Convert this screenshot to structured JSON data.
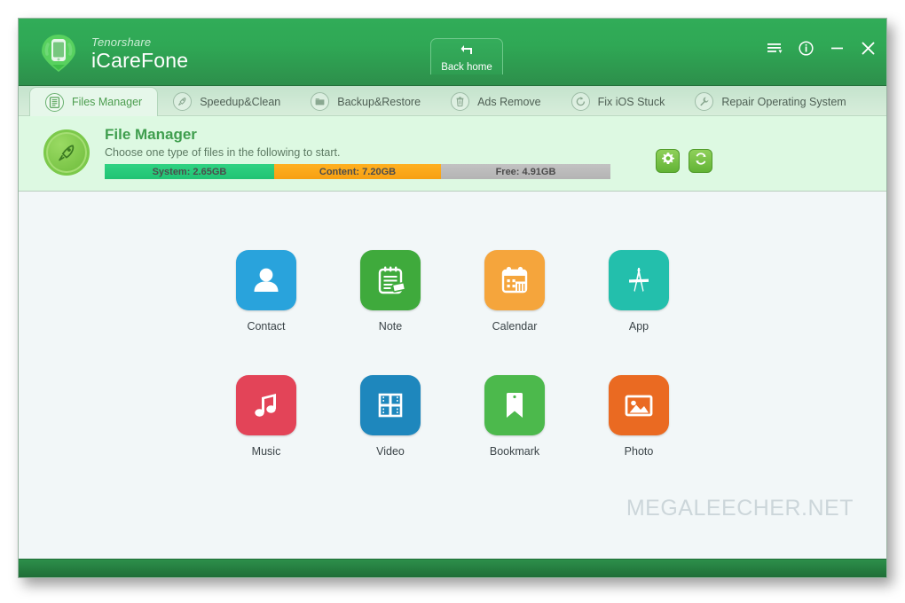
{
  "window": {
    "brand_sub": "Tenorshare",
    "brand_main": "iCareFone",
    "logo_icon": "phone-pin-logo-icon"
  },
  "titlebar": {
    "back_home_label": "Back home",
    "back_home_icon": "back-arrow-icon",
    "controls": [
      {
        "name": "menu-button",
        "icon": "hamburger-menu-icon"
      },
      {
        "name": "info-button",
        "icon": "info-circle-icon"
      },
      {
        "name": "minimize-button",
        "icon": "minimize-icon"
      },
      {
        "name": "close-button",
        "icon": "close-x-icon"
      }
    ]
  },
  "tabs": [
    {
      "label": "Files Manager",
      "icon": "document-list-icon",
      "active": true
    },
    {
      "label": "Speedup&Clean",
      "icon": "rocket-icon",
      "active": false
    },
    {
      "label": "Backup&Restore",
      "icon": "folder-icon",
      "active": false
    },
    {
      "label": "Ads Remove",
      "icon": "trash-can-icon",
      "active": false
    },
    {
      "label": "Fix iOS Stuck",
      "icon": "refresh-circle-icon",
      "active": false
    },
    {
      "label": "Repair Operating System",
      "icon": "wrench-icon",
      "active": false
    }
  ],
  "header": {
    "badge_icon": "rocket-badge-icon",
    "title": "File Manager",
    "subtitle": "Choose one type of files in the following to start.",
    "actions": [
      {
        "name": "settings-button",
        "icon": "gear-icon"
      },
      {
        "name": "refresh-button",
        "icon": "sync-refresh-icon"
      }
    ]
  },
  "storage": {
    "segments": [
      {
        "label": "System: 2.65GB",
        "value_gb": 2.65,
        "percent": 33.5,
        "color": "#21c374"
      },
      {
        "label": "Content: 7.20GB",
        "value_gb": 7.2,
        "percent": 33.0,
        "color": "#f7a012"
      },
      {
        "label": "Free: 4.91GB",
        "value_gb": 4.91,
        "percent": 33.5,
        "color": "#b4b4b4"
      }
    ]
  },
  "tiles": {
    "row1": [
      {
        "label": "Contact",
        "icon": "contact-person-icon",
        "color": "#29a3dc"
      },
      {
        "label": "Note",
        "icon": "notepad-icon",
        "color": "#3faa3c"
      },
      {
        "label": "Calendar",
        "icon": "calendar-icon",
        "color": "#f5a53c"
      },
      {
        "label": "App",
        "icon": "app-store-icon",
        "color": "#23bfac"
      }
    ],
    "row2": [
      {
        "label": "Music",
        "icon": "music-note-icon",
        "color": "#e34458"
      },
      {
        "label": "Video",
        "icon": "filmstrip-icon",
        "color": "#1e87bd"
      },
      {
        "label": "Bookmark",
        "icon": "bookmark-icon",
        "color": "#4cb94c"
      },
      {
        "label": "Photo",
        "icon": "photo-picture-icon",
        "color": "#ea6a22"
      }
    ]
  },
  "watermark": "MEGALEECHER.NET"
}
